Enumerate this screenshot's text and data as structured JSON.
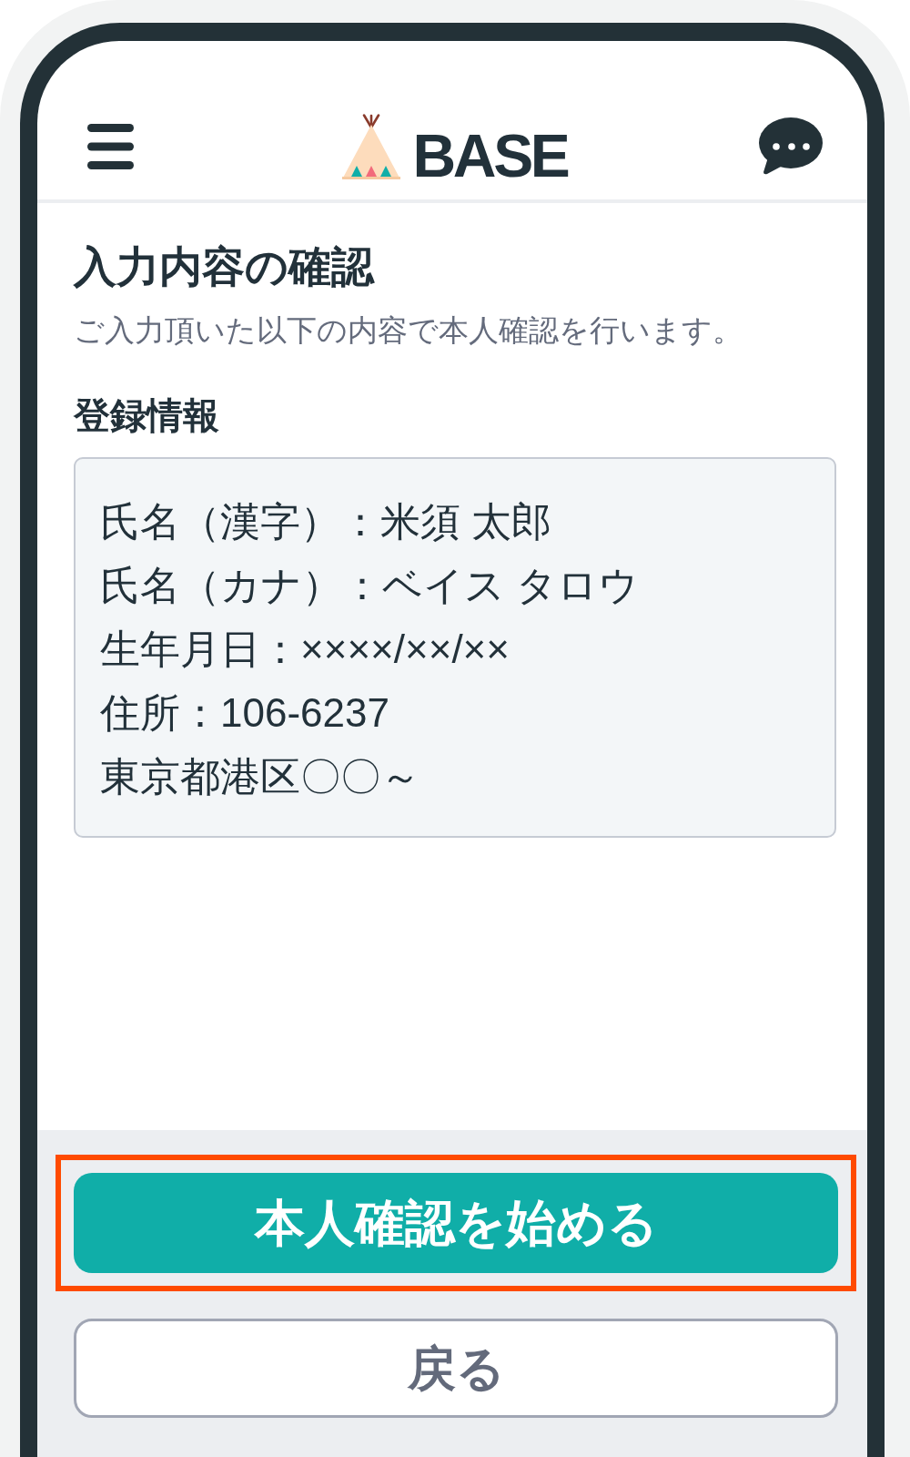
{
  "header": {
    "logo_text": "BASE"
  },
  "page": {
    "title": "入力内容の確認",
    "description": "ご入力頂いた以下の内容で本人確認を行います。"
  },
  "registration_info": {
    "heading": "登録情報",
    "lines": [
      "氏名（漢字）：米須 太郎",
      "氏名（カナ）：ベイス タロウ",
      "生年月日：××××/××/××",
      "住所：106-6237",
      "東京都港区〇〇～"
    ]
  },
  "actions": [
    {
      "kind": "primary",
      "label": "本人確認を始める",
      "highlighted": true
    },
    {
      "kind": "secondary",
      "label": "戻る",
      "highlighted": false
    }
  ]
}
